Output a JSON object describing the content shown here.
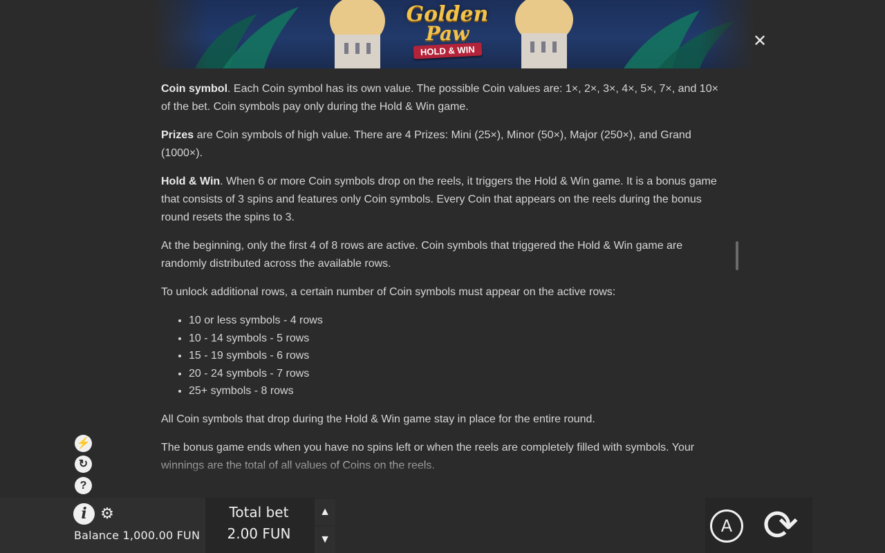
{
  "header": {
    "logo_line1": "Golden",
    "logo_line2": "Paw",
    "logo_ribbon": "HOLD & WIN",
    "close_label": "✕"
  },
  "rules": {
    "coin": {
      "term": "Coin symbol",
      "text": ". Each Coin symbol has its own value. The possible Coin values are: 1×, 2×, 3×, 4×, 5×, 7×, and 10× of the bet. Coin symbols pay only during the Hold & Win game."
    },
    "prizes": {
      "term": "Prizes",
      "text": " are Coin symbols of high value. There are 4 Prizes: Mini (25×), Minor (50×), Major (250×), and Grand (1000×)."
    },
    "holdwin": {
      "term": "Hold & Win",
      "text": ". When 6 or more Coin symbols drop on the reels, it triggers the Hold & Win game. It is a bonus game that consists of 3 spins and features only Coin symbols. Every Coin that appears on the reels during the bonus round resets the spins to 3."
    },
    "beginning": "At the beginning, only the first 4 of 8 rows are active. Coin symbols that triggered the Hold & Win game are randomly distributed across the available rows.",
    "unlock_intro": "To unlock additional rows, a certain number of Coin symbols must appear on the active rows:",
    "unlock_list": [
      "10 or less symbols - 4 rows",
      "10 - 14 symbols - 5 rows",
      "15 - 19 symbols - 6 rows",
      "20 - 24 symbols - 7 rows",
      "25+ symbols - 8 rows"
    ],
    "stay": "All Coin symbols that drop during the Hold & Win game stay in place for the entire round.",
    "end": "The bonus game ends when you have no spins left or when the reels are completely filled with symbols. Your winnings are the total of all values of Coins on the reels."
  },
  "side_icons": [
    {
      "name": "turbo-icon",
      "glyph": "⚡"
    },
    {
      "name": "quickspin-icon",
      "glyph": "↻"
    },
    {
      "name": "help-icon",
      "glyph": "?"
    }
  ],
  "bottom": {
    "info_glyph": "i",
    "gear_glyph": "⚙",
    "balance": "Balance 1,000.00 FUN",
    "bet_label": "Total bet",
    "bet_value": "2.00 FUN",
    "bet_up": "▲",
    "bet_down": "▼",
    "auto_label": "A",
    "spin_glyph": "⟳"
  },
  "colors": {
    "background": "#2b2b2b",
    "text": "#d6d6d6",
    "accent_gold": "#f2c24a",
    "ribbon_red": "#b3233a"
  }
}
